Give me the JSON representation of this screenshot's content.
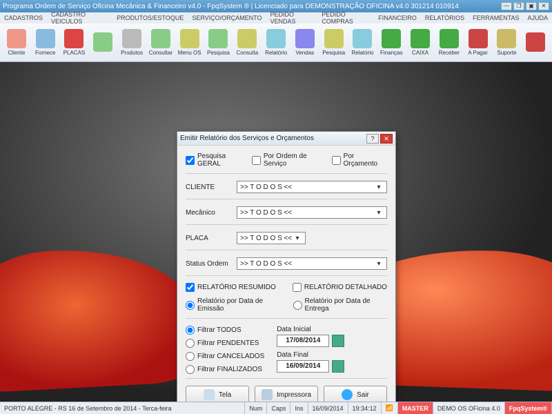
{
  "window": {
    "title": "Programa Ordem de Serviço Oficina Mecânica & Financeiro v4.0 - FpqSystem ® | Licenciado para  DEMONSTRAÇÃO OFICINA v4.0 301214 010914"
  },
  "menubar": [
    "CADASTROS",
    "CADASTRO VEICULOS",
    "PRODUTOS/ESTOQUE",
    "SERVIÇO/ORÇAMENTO",
    "PEDIDO VENDAS",
    "PEDIDO COMPRAS",
    "FINANCEIRO",
    "RELATÓRIOS",
    "FERRAMENTAS",
    "AJUDA"
  ],
  "toolbar": [
    {
      "label": "Cliente",
      "color": "#e98"
    },
    {
      "label": "Fornece",
      "color": "#8bd"
    },
    {
      "label": "PLACAS",
      "color": "#d44"
    },
    {
      "label": "",
      "color": "#8c8"
    },
    {
      "label": "Produtos",
      "color": "#bbb"
    },
    {
      "label": "Consultar",
      "color": "#8c8"
    },
    {
      "label": "Menu OS",
      "color": "#cc6"
    },
    {
      "label": "Pesquisa",
      "color": "#8c8"
    },
    {
      "label": "Consulta",
      "color": "#cc6"
    },
    {
      "label": "Relatório",
      "color": "#8cd"
    },
    {
      "label": "Vendas",
      "color": "#88e"
    },
    {
      "label": "Pesquisa",
      "color": "#cc6"
    },
    {
      "label": "Relatório",
      "color": "#8cd"
    },
    {
      "label": "Finanças",
      "color": "#4a4"
    },
    {
      "label": "CAIXA",
      "color": "#4a4"
    },
    {
      "label": "Receber",
      "color": "#4a4"
    },
    {
      "label": "A Pagar",
      "color": "#c44"
    },
    {
      "label": "Suporte",
      "color": "#cb6"
    },
    {
      "label": "",
      "color": "#c44"
    }
  ],
  "dialog": {
    "title": "Emitir Relatório dos Serviços e Orçamentos",
    "search": {
      "geral": "Pesquisa GERAL",
      "por_os": "Por Ordem de Serviço",
      "por_orc": "Por Orçamento"
    },
    "fields": {
      "cliente_label": "CLIENTE",
      "cliente_value": ">> T O D O S <<",
      "mecanico_label": "Mecânico",
      "mecanico_value": ">> T O D O S <<",
      "placa_label": "PLACA",
      "placa_value": ">> T O D O S <<",
      "status_label": "Status Ordem",
      "status_value": ">> T O D O S <<"
    },
    "report": {
      "resumido": "RELATÓRIO RESUMIDO",
      "detalhado": "RELATÓRIO DETALHADO",
      "por_emissao": "Relatório por Data de Emissão",
      "por_entrega": "Relatório por Data de Entrega"
    },
    "filter": {
      "todos": "Filtrar TODOS",
      "pendentes": "Filtrar PENDENTES",
      "cancelados": "Filtrar CANCELADOS",
      "finalizados": "Filtrar FINALIZADOS"
    },
    "dates": {
      "inicial_label": "Data Inicial",
      "inicial_value": "17/08/2014",
      "final_label": "Data Final",
      "final_value": "16/09/2014"
    },
    "buttons": {
      "tela": "Tela",
      "impressora": "Impressora",
      "sair": "Sair"
    }
  },
  "statusbar": {
    "loc": "PORTO ALEGRE - RS 16 de Setembro de 2014 - Terca-feira",
    "num": "Num",
    "caps": "Caps",
    "ins": "Ins",
    "date": "16/09/2014",
    "time": "19:34:12",
    "master": "MASTER",
    "demo": "DEMO OS OFicina 4.0",
    "brand": "FpqSystem®"
  }
}
